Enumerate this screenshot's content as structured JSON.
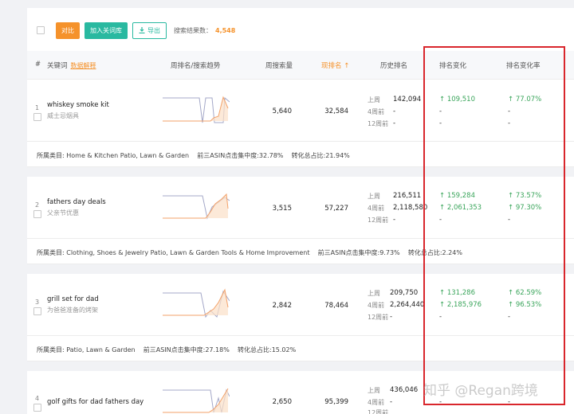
{
  "toolbar": {
    "compare_label": "对比",
    "add_to_lexicon_label": "加入关词库",
    "export_label": "导出",
    "result_count_label": "搜索结果数：",
    "result_count_value": "4,548"
  },
  "columns": {
    "index": "#",
    "keyword": "关键词",
    "data_explain": "数据解释",
    "trend": "周排名/搜索趋势",
    "weekly_search": "周搜索量",
    "current_rank": "现排名 ↑",
    "history_rank": "历史排名",
    "rank_change": "排名变化",
    "rank_change_rate": "排名变化率"
  },
  "history_labels": {
    "last_week": "上周",
    "four_weeks": "4周前",
    "twelve_weeks": "12周前"
  },
  "rows": [
    {
      "index": "1",
      "keyword": "whiskey smoke kit",
      "keyword_cn": "威士忌烟具",
      "weekly_search": "5,640",
      "current_rank": "32,584",
      "history": [
        "142,094",
        "-",
        "-"
      ],
      "rank_change": [
        "109,510",
        "-",
        "-"
      ],
      "rank_change_rate": [
        "77.07%",
        "-",
        "-"
      ],
      "category": "所属类目: Home & Kitchen Patio, Lawn & Garden",
      "top3_label": "前三ASIN点击集中度:32.78%",
      "conversion_label": "转化总占比:21.94%"
    },
    {
      "index": "2",
      "keyword": "fathers day deals",
      "keyword_cn": "父亲节优惠",
      "weekly_search": "3,515",
      "current_rank": "57,227",
      "history": [
        "216,511",
        "2,118,580",
        "-"
      ],
      "rank_change": [
        "159,284",
        "2,061,353",
        "-"
      ],
      "rank_change_rate": [
        "73.57%",
        "97.30%",
        "-"
      ],
      "category": "所属类目: Clothing, Shoes & Jewelry Patio, Lawn & Garden Tools & Home Improvement",
      "top3_label": "前三ASIN点击集中度:9.73%",
      "conversion_label": "转化总占比:2.24%"
    },
    {
      "index": "3",
      "keyword": "grill set for dad",
      "keyword_cn": "为爸爸准备的烤架",
      "weekly_search": "2,842",
      "current_rank": "78,464",
      "history": [
        "209,750",
        "2,264,440",
        "-"
      ],
      "rank_change": [
        "131,286",
        "2,185,976",
        "-"
      ],
      "rank_change_rate": [
        "62.59%",
        "96.53%",
        "-"
      ],
      "category": "所属类目: Patio, Lawn & Garden",
      "top3_label": "前三ASIN点击集中度:27.18%",
      "conversion_label": "转化总占比:15.02%"
    },
    {
      "index": "4",
      "keyword": "golf gifts for dad fathers day",
      "weekly_search": "2,650",
      "current_rank": "95,399",
      "history": [
        "436,046",
        "-",
        "-"
      ],
      "rank_change": [
        "-",
        "-"
      ],
      "rank_change_rate": [
        "-",
        "-"
      ]
    }
  ],
  "watermark": "知乎 @Regan跨境",
  "colors": {
    "orange": "#f5922b",
    "green": "#29b9a0",
    "up": "#3aa55b",
    "highlight_box": "#d9262c"
  }
}
